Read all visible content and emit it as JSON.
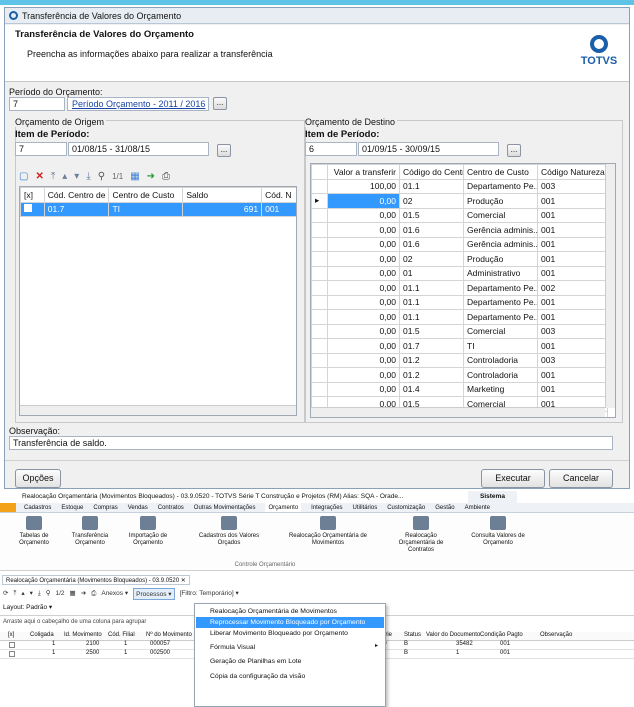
{
  "dialog": {
    "title": "Transferência de Valores do Orçamento",
    "header_title": "Transferência de Valores do Orçamento",
    "header_subtitle": "Preencha as informações abaixo para realizar a transferência",
    "logo_text": "TOTVS",
    "period_label": "Período do Orçamento:",
    "period_code": "7",
    "period_link": "Período Orçamento - 2011 / 2016",
    "origin": {
      "group_title": "Orçamento de Origem",
      "item_label": "Item de Período:",
      "item_code": "7",
      "item_range": "01/08/15 - 31/08/15",
      "pager": "1/1",
      "columns": [
        "[x]",
        "Cód. Centro de",
        "Centro de Custo",
        "Saldo",
        "Cód. N"
      ],
      "rows": [
        [
          "",
          "01.7",
          "TI",
          "691",
          "001"
        ]
      ]
    },
    "dest": {
      "group_title": "Orçamento de Destino",
      "item_label": "Item de Período:",
      "item_code": "6",
      "item_range": "01/09/15 - 30/09/15",
      "columns": [
        "Valor a transferir",
        "Código do Centro",
        "Centro de Custo",
        "Código Natureza"
      ],
      "rows": [
        [
          "100,00",
          "01.1",
          "Departamento Pe...",
          "003"
        ],
        [
          "0,00",
          "02",
          "Produção",
          "001"
        ],
        [
          "0,00",
          "01.5",
          "Comercial",
          "001"
        ],
        [
          "0,00",
          "01.6",
          "Gerência adminis...",
          "001"
        ],
        [
          "0,00",
          "01.6",
          "Gerência adminis...",
          "001"
        ],
        [
          "0,00",
          "02",
          "Produção",
          "001"
        ],
        [
          "0,00",
          "01",
          "Administrativo",
          "001"
        ],
        [
          "0,00",
          "01.1",
          "Departamento Pe...",
          "002"
        ],
        [
          "0,00",
          "01.1",
          "Departamento Pe...",
          "001"
        ],
        [
          "0,00",
          "01.1",
          "Departamento Pe...",
          "001"
        ],
        [
          "0,00",
          "01.5",
          "Comercial",
          "003"
        ],
        [
          "0,00",
          "01.7",
          "TI",
          "001"
        ],
        [
          "0,00",
          "01.2",
          "Controladoria",
          "003"
        ],
        [
          "0,00",
          "01.2",
          "Controladoria",
          "001"
        ],
        [
          "0,00",
          "01.4",
          "Marketing",
          "001"
        ],
        [
          "0,00",
          "01.5",
          "Comercial",
          "001"
        ],
        [
          "0,00",
          "01.5",
          "Comercial",
          "001"
        ]
      ]
    },
    "obs_label": "Observação:",
    "obs_value": "Transferência de saldo.",
    "options_button": "Opções",
    "execute_button": "Executar",
    "cancel_button": "Cancelar"
  },
  "app": {
    "title": "Realocação Orçamentária (Movimentos Bloqueados) - 03.9.0520 - TOTVS Série T Construção e Projetos (RM) Alias: SQA - Orade...",
    "system_label": "Sistema",
    "tabs": [
      "Cadastros",
      "Estoque",
      "Compras",
      "Vendas",
      "Contratos",
      "Outras Movimentações",
      "Orçamento",
      "Integrações",
      "Utilitários",
      "Customização",
      "Gestão",
      "Ambiente"
    ],
    "ribbon": [
      "Tabelas de Orçamento",
      "Transferência Orçamento",
      "Importação de Orçamento",
      "Cadastros dos Valores Orçados",
      "Realocação Orçamentária de Movimentos",
      "Realocação Orçamentária de Contratos",
      "Consulta Valores de Orçamento"
    ],
    "ribbon_group": "Controle Orçamentário",
    "doc_tab": "Realocação Orçamentária (Movimentos Bloqueados) - 03.9.0520",
    "pager": "1/2",
    "anexos": "Anexos",
    "processos": "Processos",
    "filter": "[Filtro: Temporário]",
    "layout": "Layout:",
    "layout_value": "Padrão",
    "group_hint": "Arraste aqui o cabeçalho de uma coluna para agrupar",
    "columns": [
      "[x]",
      "Coligada",
      "Id. Movimento",
      "Cód. Filial",
      "Nº do Movimento"
    ],
    "columns_right": [
      "Série",
      "Status",
      "Valor do Documento",
      "Condição Pagto",
      "Observação"
    ],
    "rows": [
      {
        "c": [
          "1",
          "2100",
          "1",
          "000057"
        ],
        "r": [
          "O PAULO",
          "O",
          "B",
          "35482",
          "001"
        ]
      },
      {
        "c": [
          "1",
          "2500",
          "1",
          "002500"
        ],
        "r": [
          "",
          "V",
          "B",
          "1",
          "001"
        ]
      }
    ],
    "menu": [
      "Realocação Orçamentária de Movimentos",
      "Reprocessar Movimento Bloqueado por Orçamento",
      "Liberar Movimento Bloqueado por Orçamento",
      "Fórmula Visual",
      "Geração de Planilhas em Lote",
      "Cópia da configuração da visão"
    ]
  }
}
